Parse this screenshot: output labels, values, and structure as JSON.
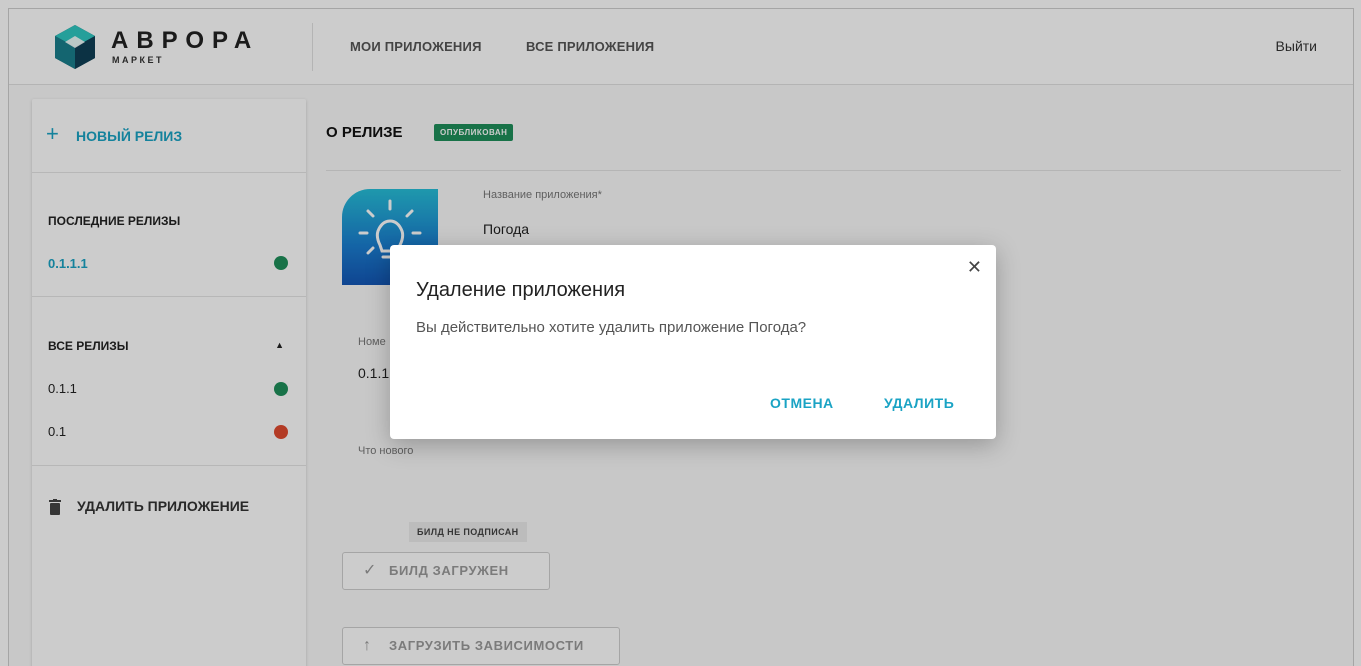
{
  "header": {
    "logo_word": "АВРОРА",
    "logo_sub": "МАРКЕТ",
    "nav": [
      "МОИ ПРИЛОЖЕНИЯ",
      "ВСЕ ПРИЛОЖЕНИЯ"
    ],
    "logout": "Выйти"
  },
  "sidebar": {
    "new_release": "НОВЫЙ РЕЛИЗ",
    "latest_title": "ПОСЛЕДНИЕ РЕЛИЗЫ",
    "latest": [
      {
        "label": "0.1.1.1",
        "status": "published"
      }
    ],
    "all_title": "ВСЕ РЕЛИЗЫ",
    "all": [
      {
        "label": "0.1.1",
        "status": "published"
      },
      {
        "label": "0.1",
        "status": "rejected"
      }
    ],
    "delete_app": "УДАЛИТЬ ПРИЛОЖЕНИЕ"
  },
  "main": {
    "title": "О РЕЛИЗЕ",
    "status_badge": "ОПУБЛИКОВАН",
    "app_name_label": "Название приложения*",
    "app_name_value": "Погода",
    "version_label": "Номе",
    "version_value": "0.1.1",
    "whats_new_label": "Что нового",
    "build_chip": "БИЛД НЕ ПОДПИСАН",
    "build_uploaded": "БИЛД ЗАГРУЖЕН",
    "upload_deps": "ЗАГРУЗИТЬ ЗАВИСИМОСТИ"
  },
  "modal": {
    "title": "Удаление приложения",
    "text": "Вы действительно хотите удалить приложение Погода?",
    "cancel": "ОТМЕНА",
    "delete": "УДАЛИТЬ"
  },
  "colors": {
    "accent": "#1aa3c4",
    "published": "#1f8f5a",
    "rejected": "#e04a2f",
    "overlay": "rgba(0,0,0,0.2)"
  },
  "icons": [
    "aurora-logo-icon",
    "plus-icon",
    "caret-up-icon",
    "trash-icon",
    "lightbulb-icon",
    "check-icon",
    "arrow-up-icon",
    "close-icon"
  ]
}
